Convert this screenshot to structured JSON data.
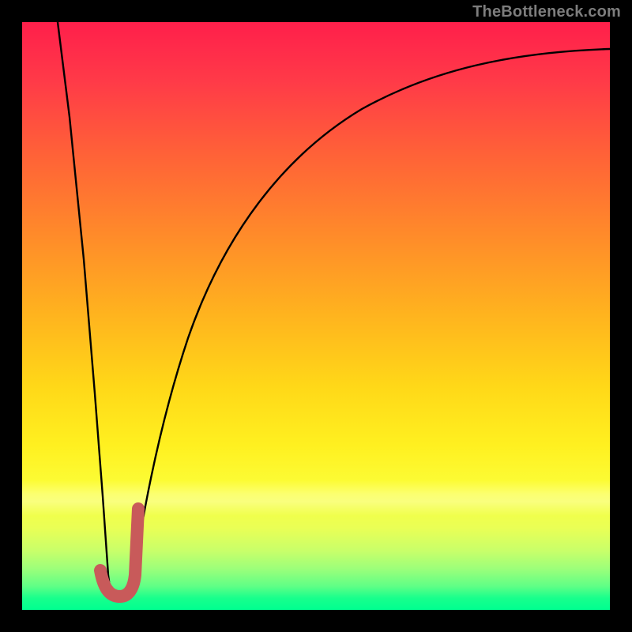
{
  "watermark": "TheBottleneck.com",
  "colors": {
    "frame": "#000000",
    "curve": "#000000",
    "marker": "#c85a5a",
    "gradient_top": "#ff1f4b",
    "gradient_bottom": "#00ff90"
  },
  "chart_data": {
    "type": "line",
    "title": "",
    "xlabel": "",
    "ylabel": "",
    "xlim": [
      0,
      100
    ],
    "ylim": [
      0,
      100
    ],
    "grid": false,
    "legend": false,
    "note": "No axis ticks or numeric labels are visible; x/y are normalized 0–100. Curve y-values are percent height from bottom (0 = bottom green edge, 100 = top red edge). Values estimated from pixel positions.",
    "series": [
      {
        "name": "left-descent",
        "type": "line",
        "x": [
          6,
          8,
          10,
          12,
          13.5,
          14.5
        ],
        "values": [
          100,
          80,
          55,
          30,
          12,
          3
        ]
      },
      {
        "name": "right-ascent",
        "type": "line",
        "x": [
          18,
          20,
          24,
          30,
          38,
          48,
          60,
          72,
          84,
          96,
          100
        ],
        "values": [
          3,
          16,
          36,
          55,
          68,
          77,
          83,
          87,
          89.5,
          91,
          91.5
        ]
      },
      {
        "name": "j-marker",
        "type": "line",
        "color": "#c85a5a",
        "stroke_width_px": 16,
        "x": [
          13.2,
          14.5,
          16.2,
          17.8,
          18.6,
          19.0,
          19.2
        ],
        "values": [
          7,
          3.2,
          2.6,
          3.4,
          6.5,
          12,
          18
        ]
      }
    ]
  }
}
